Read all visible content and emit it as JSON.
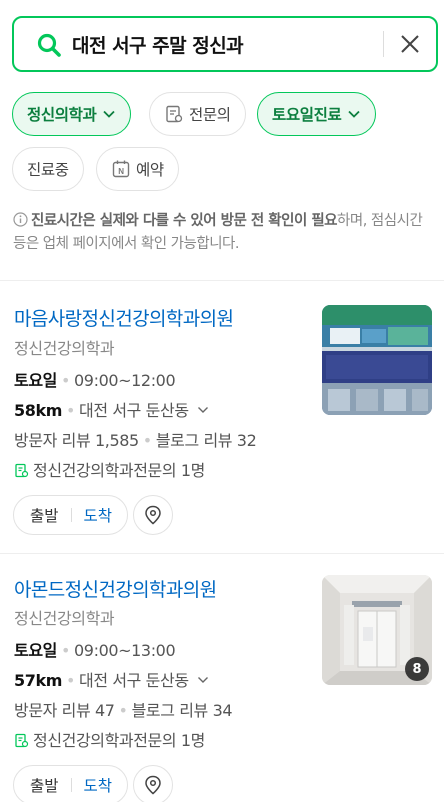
{
  "search": {
    "query": "대전 서구 주말 정신과"
  },
  "filters": [
    {
      "label": "정신의학과",
      "active": true,
      "has_chevron": true,
      "icon": ""
    },
    {
      "label": "전문의",
      "active": false,
      "has_chevron": false,
      "icon": "doctor-certificate-icon"
    },
    {
      "label": "토요일진료",
      "active": true,
      "has_chevron": true,
      "icon": ""
    },
    {
      "label": "진료중",
      "active": false,
      "has_chevron": false,
      "icon": ""
    },
    {
      "label": "예약",
      "active": false,
      "has_chevron": false,
      "icon": "naver-booking-icon"
    }
  ],
  "notice": {
    "bold": "진료시간은 실제와 다를 수 있어 방문 전 확인이 필요",
    "rest": "하며, 점심시간 등은 업체 페이지에서 확인 가능합니다."
  },
  "results": [
    {
      "name": "마음사랑정신건강의학과의원",
      "category": "정신건강의학과",
      "day": "토요일",
      "hours": "09:00~12:00",
      "distance": "58km",
      "address": "대전 서구 둔산동",
      "visitor_reviews": "방문자 리뷰 1,585",
      "blog_reviews": "블로그 리뷰 32",
      "specialist": "정신건강의학과전문의 1명",
      "depart_label": "출발",
      "arrive_label": "도착",
      "photo_count": ""
    },
    {
      "name": "아몬드정신건강의학과의원",
      "category": "정신건강의학과",
      "day": "토요일",
      "hours": "09:00~13:00",
      "distance": "57km",
      "address": "대전 서구 둔산동",
      "visitor_reviews": "방문자 리뷰 47",
      "blog_reviews": "블로그 리뷰 34",
      "specialist": "정신건강의학과전문의 1명",
      "depart_label": "출발",
      "arrive_label": "도착",
      "photo_count": "8"
    }
  ],
  "colors": {
    "accent": "#03c75a",
    "link": "#0068c3"
  }
}
